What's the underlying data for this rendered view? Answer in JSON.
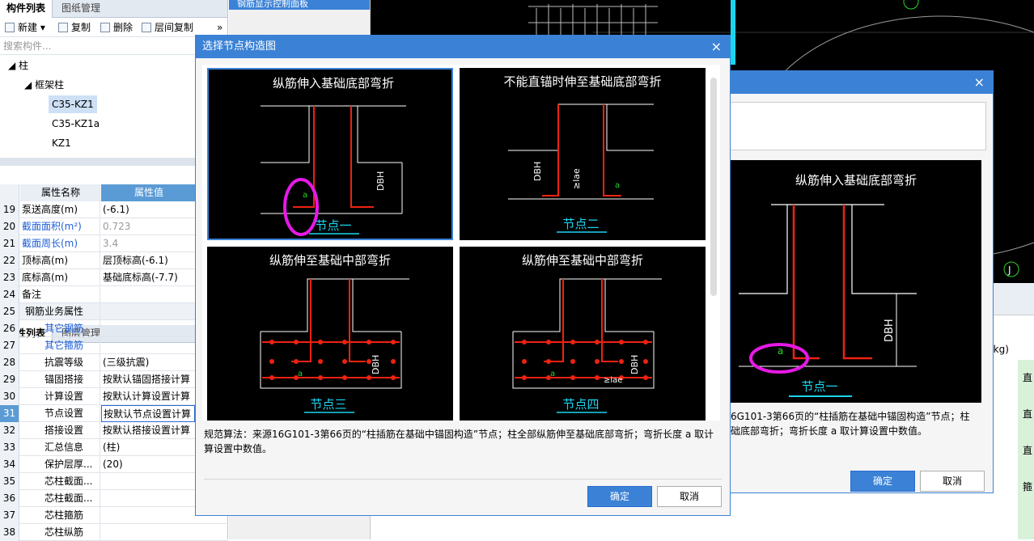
{
  "left_panel": {
    "tabs": [
      "构件列表",
      "图纸管理"
    ],
    "toolbar": {
      "new": "新建",
      "copy": "复制",
      "delete": "删除",
      "floor_copy": "层间复制",
      "more": "»"
    },
    "search_placeholder": "搜索构件...",
    "tree": {
      "root": "柱",
      "child": "框架柱",
      "items": [
        "C35-KZ1",
        "C35-KZ1a",
        "KZ1"
      ],
      "selected": "C35-KZ1"
    },
    "prop_tabs": [
      "属性列表",
      "图层管理"
    ],
    "prop_headers": {
      "name": "属性名称",
      "value": "属性值"
    },
    "props": [
      {
        "n": "19",
        "k": "泵送高度(m)",
        "v": "(-6.1)"
      },
      {
        "n": "20",
        "k": "截面面积(m²)",
        "v": "0.723"
      },
      {
        "n": "21",
        "k": "截面周长(m)",
        "v": "3.4"
      },
      {
        "n": "22",
        "k": "顶标高(m)",
        "v": "层顶标高(-6.1)"
      },
      {
        "n": "23",
        "k": "底标高(m)",
        "v": "基础底标高(-7.7)"
      },
      {
        "n": "24",
        "k": "备注",
        "v": ""
      },
      {
        "n": "25",
        "k": "钢筋业务属性",
        "v": ""
      },
      {
        "n": "26",
        "k": "其它钢筋",
        "v": ""
      },
      {
        "n": "27",
        "k": "其它箍筋",
        "v": ""
      },
      {
        "n": "28",
        "k": "抗震等级",
        "v": "(三级抗震)"
      },
      {
        "n": "29",
        "k": "锚固搭接",
        "v": "按默认锚固搭接计算"
      },
      {
        "n": "30",
        "k": "计算设置",
        "v": "按默认计算设置计算"
      },
      {
        "n": "31",
        "k": "节点设置",
        "v": "按默认节点设置计算"
      },
      {
        "n": "32",
        "k": "搭接设置",
        "v": "按默认搭接设置计算"
      },
      {
        "n": "33",
        "k": "汇总信息",
        "v": "(柱)"
      },
      {
        "n": "34",
        "k": "保护层厚...",
        "v": "(20)"
      },
      {
        "n": "35",
        "k": "芯柱截面...",
        "v": ""
      },
      {
        "n": "36",
        "k": "芯柱截面...",
        "v": ""
      },
      {
        "n": "37",
        "k": "芯柱箍筋",
        "v": ""
      },
      {
        "n": "38",
        "k": "芯柱纵筋",
        "v": ""
      }
    ]
  },
  "top_panel_title": "钢筋显示控制面板",
  "cad_labels": {
    "j": "J"
  },
  "main_dialog": {
    "title": "选择节点构造图",
    "close": "×",
    "images": [
      {
        "title": "纵筋伸入基础底部弯折",
        "node": "节点一",
        "label_a": "a",
        "label_dbh": "DBH"
      },
      {
        "title": "不能直锚时伸至基础底部弯折",
        "node": "节点二",
        "label_a": "a",
        "label_dbh": "DBH",
        "label_lae": "≥lae"
      },
      {
        "title": "纵筋伸至基础中部弯折",
        "node": "节点三",
        "label_a": "a",
        "label_dbh": "DBH"
      },
      {
        "title": "纵筋伸至基础中部弯折",
        "node": "节点四",
        "label_a": "a",
        "label_dbh": "DBH",
        "label_lae": "≥lae"
      }
    ],
    "description": "规范算法：来源16G101-3第66页的“柱插筋在基础中锚固构造”节点；柱全部纵筋伸至基础底部弯折；弯折长度 a 取计算设置中数值。",
    "ok": "确定",
    "cancel": "取消"
  },
  "back_dialog": {
    "close": "×",
    "image_title": "纵筋伸入基础底部弯折",
    "node": "节点一",
    "description_line1": "6G101-3第66页的“柱插筋在基础中锚固构造”节点；柱",
    "description_line2": "础底部弯折；弯折长度 a 取计算设置中数值。",
    "ok": "确定",
    "cancel": "取消",
    "label_a": "a",
    "label_dbh": "DBH"
  },
  "right_table": {
    "header_kg": "(kg)",
    "col_cells": [
      "直",
      "直",
      "直",
      "箍"
    ]
  }
}
